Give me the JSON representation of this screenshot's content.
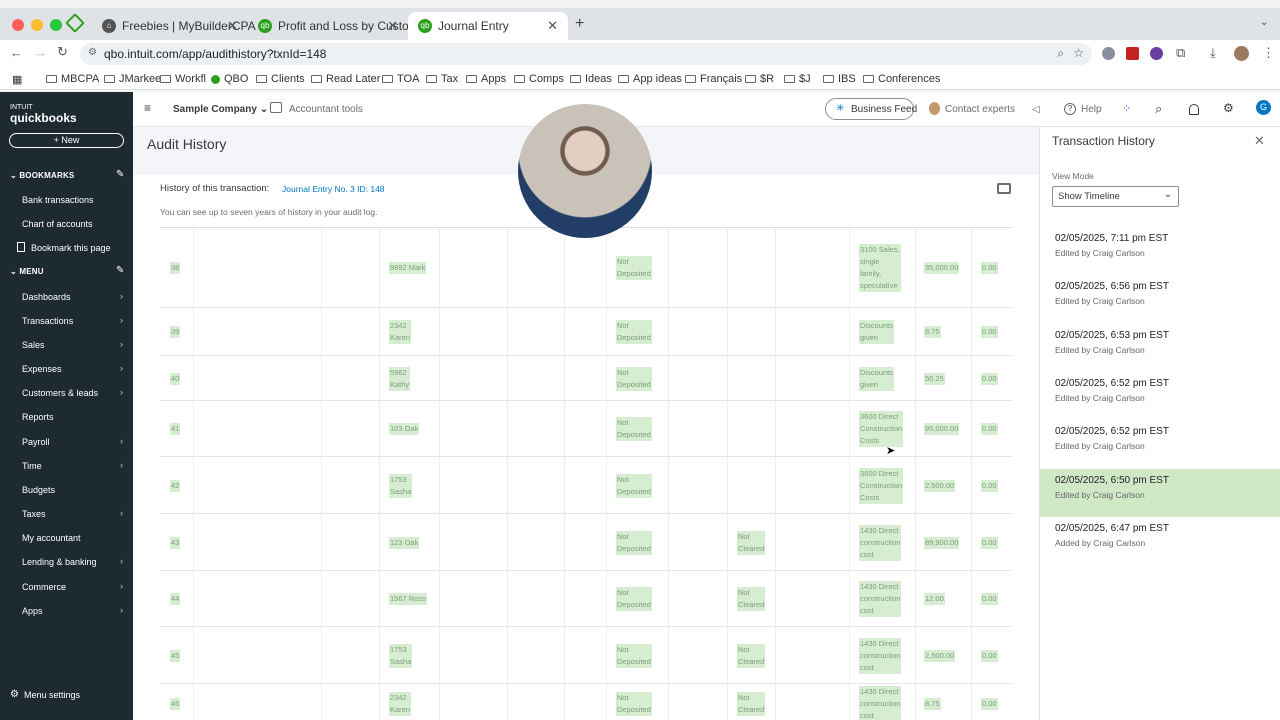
{
  "browser": {
    "tabs": [
      {
        "label": "Freebies | MyBuilderCPA",
        "active": false
      },
      {
        "label": "Profit and Loss by Customer",
        "active": false
      },
      {
        "label": "Journal Entry",
        "active": true
      }
    ],
    "url": "qbo.intuit.com/app/audithistory?txnId=148",
    "bookmarks": [
      "MBCPA",
      "JMarkee",
      "Workfl",
      "QBO",
      "Clients",
      "Read Later",
      "TOA",
      "Tax",
      "Apps",
      "Comps",
      "Ideas",
      "App ideas",
      "Français",
      "$R",
      "$J",
      "IBS",
      "Conferences"
    ]
  },
  "sidebar": {
    "logo_top": "INTUIT",
    "logo": "quickbooks",
    "new_label": "New",
    "bookmarks_title": "BOOKMARKS",
    "bookmark_items": [
      "Bank transactions",
      "Chart of accounts",
      "Bookmark this page"
    ],
    "menu_title": "MENU",
    "menu_items": [
      "Dashboards",
      "Transactions",
      "Sales",
      "Expenses",
      "Customers & leads",
      "Reports",
      "Payroll",
      "Time",
      "Budgets",
      "Taxes",
      "My accountant",
      "Lending & banking",
      "Commerce",
      "Apps"
    ],
    "menu_settings": "Menu settings"
  },
  "topbar": {
    "company": "Sample Company",
    "accountant_tools": "Accountant tools",
    "business_feed": "Business Feed",
    "contact_experts": "Contact experts",
    "help": "Help",
    "avatar_letter": "G"
  },
  "audit": {
    "title": "Audit History",
    "history_label": "History of this transaction:",
    "txn_link": "Journal Entry No. 3 ID: 148",
    "note": "You can see up to seven years of history in your audit log.",
    "rows": [
      {
        "n": "38",
        "name": "9892 Mark",
        "status": "Not\nDeposited",
        "clear": "",
        "account": "3100 Sales,\nsingle\nfamily,\nspeculative",
        "amount": "35,000.00",
        "zero": "0.00"
      },
      {
        "n": "39",
        "name": "2342\nKaren",
        "status": "Not\nDeposited",
        "clear": "",
        "account": "Discounts\ngiven",
        "amount": "8.75",
        "zero": "0.00"
      },
      {
        "n": "40",
        "name": "5962\nKathy",
        "status": "Not\nDeposited",
        "clear": "",
        "account": "Discounts\ngiven",
        "amount": "50.25",
        "zero": "0.00"
      },
      {
        "n": "41",
        "name": "103 Oak",
        "status": "Not\nDeposited",
        "clear": "",
        "account": "3600 Direct\nConstruction\nCosts",
        "amount": "95,000.00",
        "zero": "0.00"
      },
      {
        "n": "42",
        "name": "1753\nSasha",
        "status": "Not\nDeposited",
        "clear": "",
        "account": "3600 Direct\nConstruction\nCosts",
        "amount": "2,500.00",
        "zero": "0.00"
      },
      {
        "n": "43",
        "name": "123 Oak",
        "status": "Not\nDeposited",
        "clear": "Not\nCleared",
        "account": "1430 Direct\nconstruction\ncost",
        "amount": "89,900.00",
        "zero": "0.00"
      },
      {
        "n": "44",
        "name": "1567 Ross",
        "status": "Not\nDeposited",
        "clear": "Not\nCleared",
        "account": "1430 Direct\nconstruction\ncost",
        "amount": "12.00",
        "zero": "0.00"
      },
      {
        "n": "45",
        "name": "1753\nSasha",
        "status": "Not\nDeposited",
        "clear": "Not\nCleared",
        "account": "1430 Direct\nconstruction\ncost",
        "amount": "2,500.00",
        "zero": "0.00"
      },
      {
        "n": "46",
        "name": "2342\nKaren",
        "status": "Not\nDeposited",
        "clear": "Not\nCleared",
        "account": "1430 Direct\nconstruction\ncost",
        "amount": "8.75",
        "zero": "0.00"
      }
    ]
  },
  "panel": {
    "title": "Transaction History",
    "view_mode_label": "View Mode",
    "view_mode_value": "Show Timeline",
    "entries": [
      {
        "date": "02/05/2025, 7:11 pm EST",
        "by": "Edited by Craig Carlson",
        "selected": false
      },
      {
        "date": "02/05/2025, 6:56 pm EST",
        "by": "Edited by Craig Carlson",
        "selected": false
      },
      {
        "date": "02/05/2025, 6:53 pm EST",
        "by": "Edited by Craig Carlson",
        "selected": false
      },
      {
        "date": "02/05/2025, 6:52 pm EST",
        "by": "Edited by Craig Carlson",
        "selected": false
      },
      {
        "date": "02/05/2025, 6:52 pm EST",
        "by": "Edited by Craig Carlson",
        "selected": false
      },
      {
        "date": "02/05/2025, 6:50 pm EST",
        "by": "Edited by Craig Carlson",
        "selected": true
      },
      {
        "date": "02/05/2025, 6:47 pm EST",
        "by": "Added by Craig Carlson",
        "selected": false
      }
    ]
  },
  "colors": {
    "brand": "#2ca01c",
    "sidebar": "#1e2a32",
    "selected": "#cfe9c7",
    "link": "#0077c5"
  }
}
